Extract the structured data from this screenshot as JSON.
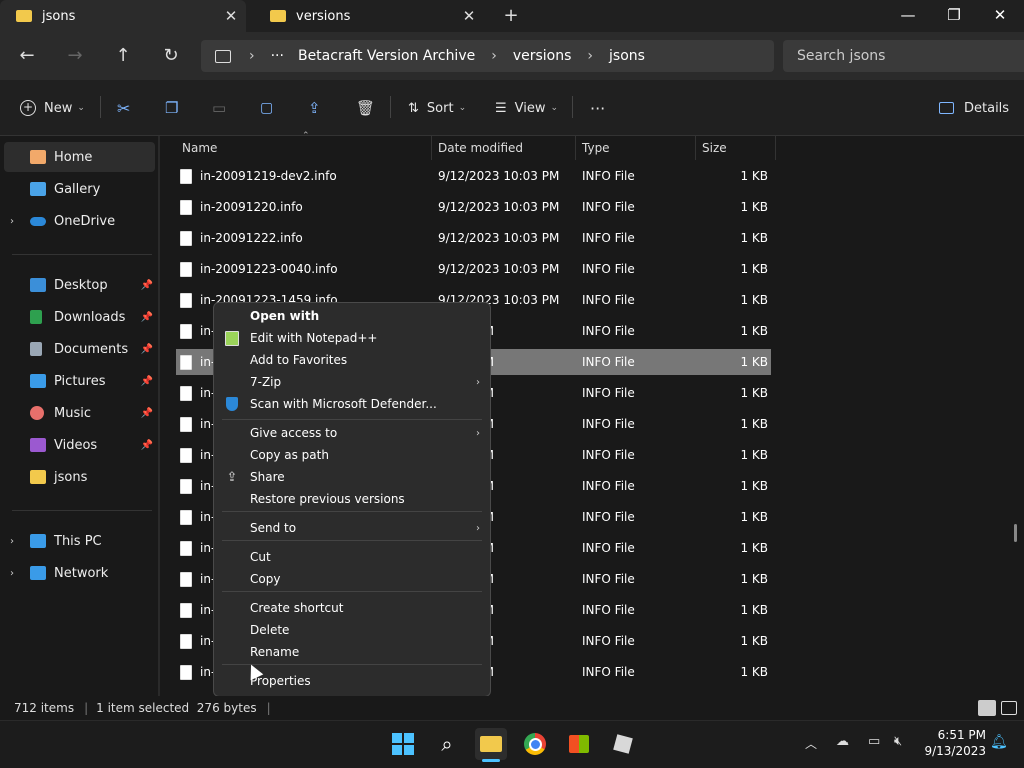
{
  "tabs": [
    {
      "label": "jsons",
      "active": true
    },
    {
      "label": "versions",
      "active": false
    }
  ],
  "breadcrumb": [
    "Betacraft Version Archive",
    "versions",
    "jsons"
  ],
  "search": {
    "placeholder": "Search jsons"
  },
  "toolbar": {
    "new_label": "New",
    "sort_label": "Sort",
    "view_label": "View",
    "details_label": "Details"
  },
  "sidebar": {
    "items": [
      {
        "label": "Home",
        "icon": "home-icon"
      },
      {
        "label": "Gallery",
        "icon": "gallery-icon"
      },
      {
        "label": "OneDrive",
        "icon": "onedrive-icon"
      },
      {
        "label": "Desktop",
        "icon": "desktop-icon"
      },
      {
        "label": "Downloads",
        "icon": "downloads-icon"
      },
      {
        "label": "Documents",
        "icon": "documents-icon"
      },
      {
        "label": "Pictures",
        "icon": "pictures-icon"
      },
      {
        "label": "Music",
        "icon": "music-icon"
      },
      {
        "label": "Videos",
        "icon": "videos-icon"
      },
      {
        "label": "jsons",
        "icon": "folder-icon"
      },
      {
        "label": "This PC",
        "icon": "this-pc-icon"
      },
      {
        "label": "Network",
        "icon": "network-icon"
      }
    ]
  },
  "columns": [
    "Name",
    "Date modified",
    "Type",
    "Size"
  ],
  "files": [
    {
      "name": "in-20091219-dev2.info",
      "date": "9/12/2023 10:03 PM",
      "type": "INFO File",
      "size": "1 KB"
    },
    {
      "name": "in-20091220.info",
      "date": "9/12/2023 10:03 PM",
      "type": "INFO File",
      "size": "1 KB"
    },
    {
      "name": "in-20091222.info",
      "date": "9/12/2023 10:03 PM",
      "type": "INFO File",
      "size": "1 KB"
    },
    {
      "name": "in-20091223-0040.info",
      "date": "9/12/2023 10:03 PM",
      "type": "INFO File",
      "size": "1 KB"
    },
    {
      "name": "in-20091223-1459.info",
      "date": "9/12/2023 10:03 PM",
      "type": "INFO File",
      "size": "1 KB"
    },
    {
      "name": "in-",
      "date": "10:03 PM",
      "type": "INFO File",
      "size": "1 KB"
    },
    {
      "name": "in-",
      "date": "10:03 PM",
      "type": "INFO File",
      "size": "1 KB"
    },
    {
      "name": "in-",
      "date": "10:03 PM",
      "type": "INFO File",
      "size": "1 KB"
    },
    {
      "name": "in-",
      "date": "10:03 PM",
      "type": "INFO File",
      "size": "1 KB"
    },
    {
      "name": "in-",
      "date": "10:03 PM",
      "type": "INFO File",
      "size": "1 KB"
    },
    {
      "name": "in-",
      "date": "10:03 PM",
      "type": "INFO File",
      "size": "1 KB"
    },
    {
      "name": "in-",
      "date": "10:03 PM",
      "type": "INFO File",
      "size": "1 KB"
    },
    {
      "name": "in-",
      "date": "10:03 PM",
      "type": "INFO File",
      "size": "1 KB"
    },
    {
      "name": "in-",
      "date": "10:03 PM",
      "type": "INFO File",
      "size": "1 KB"
    },
    {
      "name": "in-",
      "date": "10:03 PM",
      "type": "INFO File",
      "size": "1 KB"
    },
    {
      "name": "in-",
      "date": "10:03 PM",
      "type": "INFO File",
      "size": "1 KB"
    },
    {
      "name": "in-",
      "date": "10:03 PM",
      "type": "INFO File",
      "size": "1 KB"
    }
  ],
  "context_menu": {
    "items": [
      {
        "label": "Open with"
      },
      {
        "label": "Edit with Notepad++"
      },
      {
        "label": "Add to Favorites"
      },
      {
        "label": "7-Zip"
      },
      {
        "label": "Scan with Microsoft Defender..."
      },
      {
        "label": "Give access to"
      },
      {
        "label": "Copy as path"
      },
      {
        "label": "Share"
      },
      {
        "label": "Restore previous versions"
      },
      {
        "label": "Send to"
      },
      {
        "label": "Cut"
      },
      {
        "label": "Copy"
      },
      {
        "label": "Create shortcut"
      },
      {
        "label": "Delete"
      },
      {
        "label": "Rename"
      },
      {
        "label": "Properties"
      }
    ]
  },
  "status": {
    "items_count": "712 items",
    "selection": "1 item selected  276 bytes"
  },
  "clock": {
    "time": "6:51 PM",
    "date": "9/13/2023"
  },
  "colors": {
    "accent": "#0078d4",
    "folder": "#f2c94c",
    "selected_row": "#777777"
  }
}
